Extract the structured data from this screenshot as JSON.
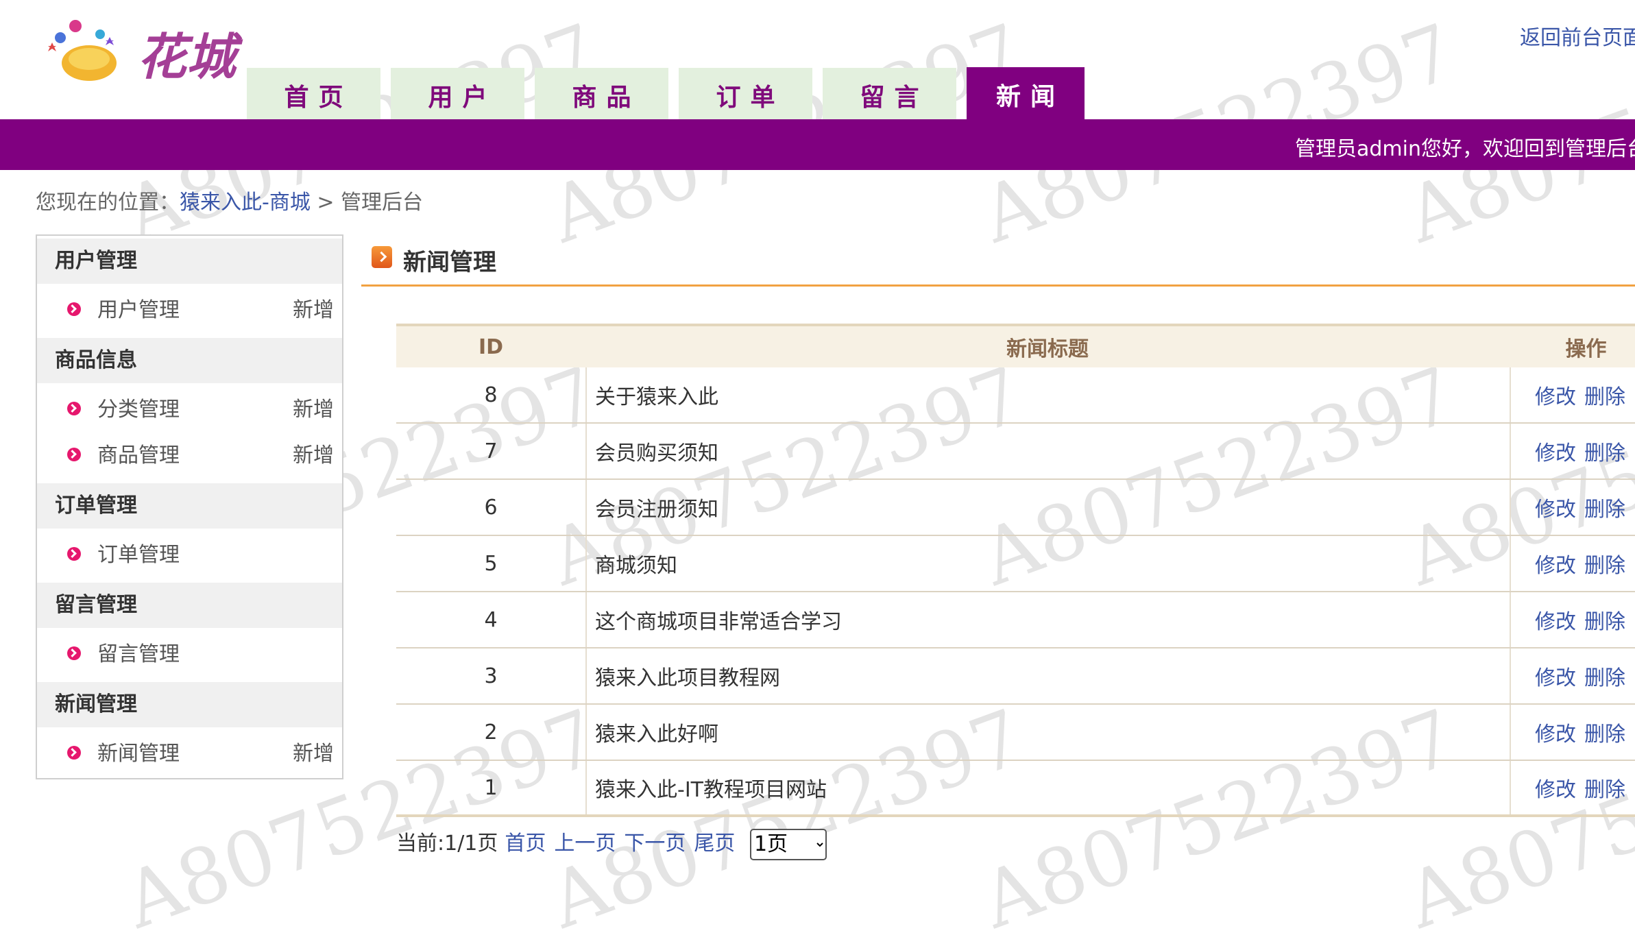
{
  "header": {
    "logo_text": "花城",
    "return_link": "返回前台页面",
    "welcome": "管理员admin您好，欢迎回到管理后台"
  },
  "nav": {
    "tabs": [
      {
        "label": "首页",
        "active": false
      },
      {
        "label": "用户",
        "active": false
      },
      {
        "label": "商品",
        "active": false
      },
      {
        "label": "订单",
        "active": false
      },
      {
        "label": "留言",
        "active": false
      },
      {
        "label": "新闻",
        "active": true
      }
    ]
  },
  "breadcrumb": {
    "prefix": "您现在的位置：",
    "site": "猿来入此-商城",
    "separator": " > ",
    "current": "管理后台"
  },
  "sidebar": {
    "groups": [
      {
        "title": "用户管理",
        "items": [
          {
            "label": "用户管理",
            "add": "新增"
          }
        ]
      },
      {
        "title": "商品信息",
        "items": [
          {
            "label": "分类管理",
            "add": "新增"
          },
          {
            "label": "商品管理",
            "add": "新增"
          }
        ]
      },
      {
        "title": "订单管理",
        "items": [
          {
            "label": "订单管理",
            "add": ""
          }
        ]
      },
      {
        "title": "留言管理",
        "items": [
          {
            "label": "留言管理",
            "add": ""
          }
        ]
      },
      {
        "title": "新闻管理",
        "items": [
          {
            "label": "新闻管理",
            "add": "新增"
          }
        ]
      }
    ]
  },
  "content": {
    "title": "新闻管理",
    "columns": [
      "ID",
      "新闻标题",
      "操作"
    ],
    "rows": [
      {
        "id": "8",
        "title": "关于猿来入此",
        "edit": "修改",
        "delete": "删除"
      },
      {
        "id": "7",
        "title": "会员购买须知",
        "edit": "修改",
        "delete": "删除"
      },
      {
        "id": "6",
        "title": "会员注册须知",
        "edit": "修改",
        "delete": "删除"
      },
      {
        "id": "5",
        "title": "商城须知",
        "edit": "修改",
        "delete": "删除"
      },
      {
        "id": "4",
        "title": "这个商城项目非常适合学习",
        "edit": "修改",
        "delete": "删除"
      },
      {
        "id": "3",
        "title": "猿来入此项目教程网",
        "edit": "修改",
        "delete": "删除"
      },
      {
        "id": "2",
        "title": "猿来入此好啊",
        "edit": "修改",
        "delete": "删除"
      },
      {
        "id": "1",
        "title": "猿来入此-IT教程项目网站",
        "edit": "修改",
        "delete": "删除"
      }
    ]
  },
  "pager": {
    "status": "当前:1/1页",
    "first": "首页",
    "prev": "上一页",
    "next": "下一页",
    "last": "尾页",
    "selected": "1页"
  },
  "watermark": "A807522397",
  "colors": {
    "brand": "#800080",
    "tab_bg": "#e3f0de",
    "link": "#3a56a8",
    "accent_orange": "#f1a141",
    "bullet": "#e6176d"
  }
}
